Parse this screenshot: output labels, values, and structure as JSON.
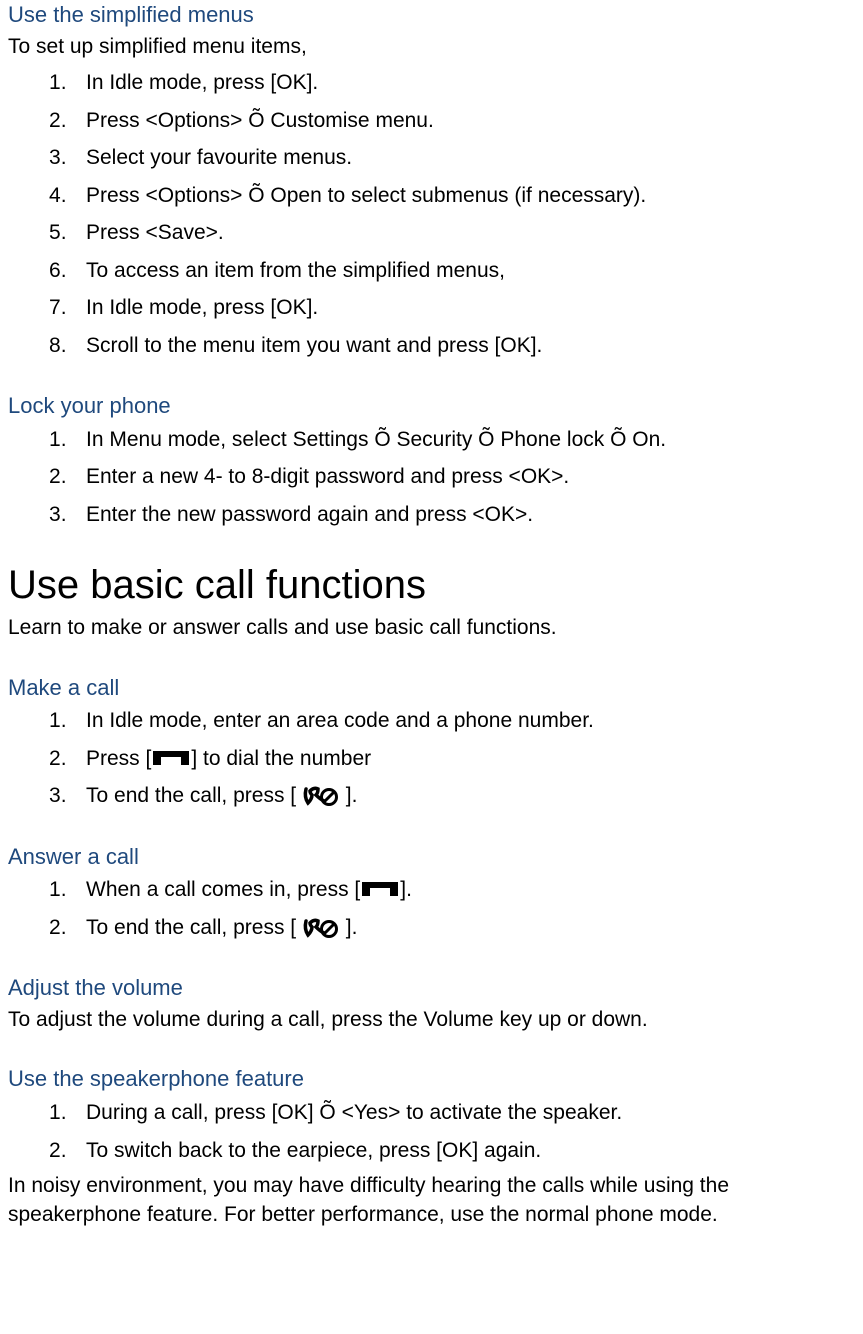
{
  "section1": {
    "title": "Use the simplified menus",
    "intro": "To set up simplified menu items,",
    "steps": [
      "In Idle mode, press [OK].",
      "Press <Options> Õ Customise menu.",
      "Select your favourite menus.",
      "Press <Options> Õ Open to select submenus (if necessary).",
      "Press <Save>.",
      "To access an item from the simplified menus,",
      "In Idle mode, press [OK].",
      "Scroll to the menu item you want and press [OK]."
    ]
  },
  "section2": {
    "title": "Lock your phone",
    "steps": [
      "In Menu mode, select Settings Õ Security Õ Phone lock Õ On.",
      "Enter a new 4- to 8-digit password and press <OK>.",
      "Enter the new password again and press <OK>."
    ]
  },
  "bigHeading": "Use basic call functions",
  "bigIntro": "Learn to make or answer calls and use basic call functions.",
  "section3": {
    "title": "Make a call",
    "step1": "In Idle mode, enter an area code and a phone number.",
    "step2_a": "Press [",
    "step2_b": "] to dial the number",
    "step3_a": "To end the call, press [ ",
    "step3_b": " ]."
  },
  "section4": {
    "title": "Answer a call",
    "step1_a": "When a call comes in, press [",
    "step1_b": "].",
    "step2_a": "To end the call, press [ ",
    "step2_b": " ]."
  },
  "section5": {
    "title": "Adjust the volume",
    "text": "To adjust the volume during a call, press the Volume key up or down."
  },
  "section6": {
    "title": "Use the speakerphone feature",
    "steps": [
      "During a call, press [OK] Õ <Yes> to activate the speaker.",
      "To switch back to the earpiece, press [OK] again."
    ],
    "note": "In noisy environment, you may have difficulty hearing the calls while using the speakerphone feature. For better performance, use the normal phone mode."
  }
}
